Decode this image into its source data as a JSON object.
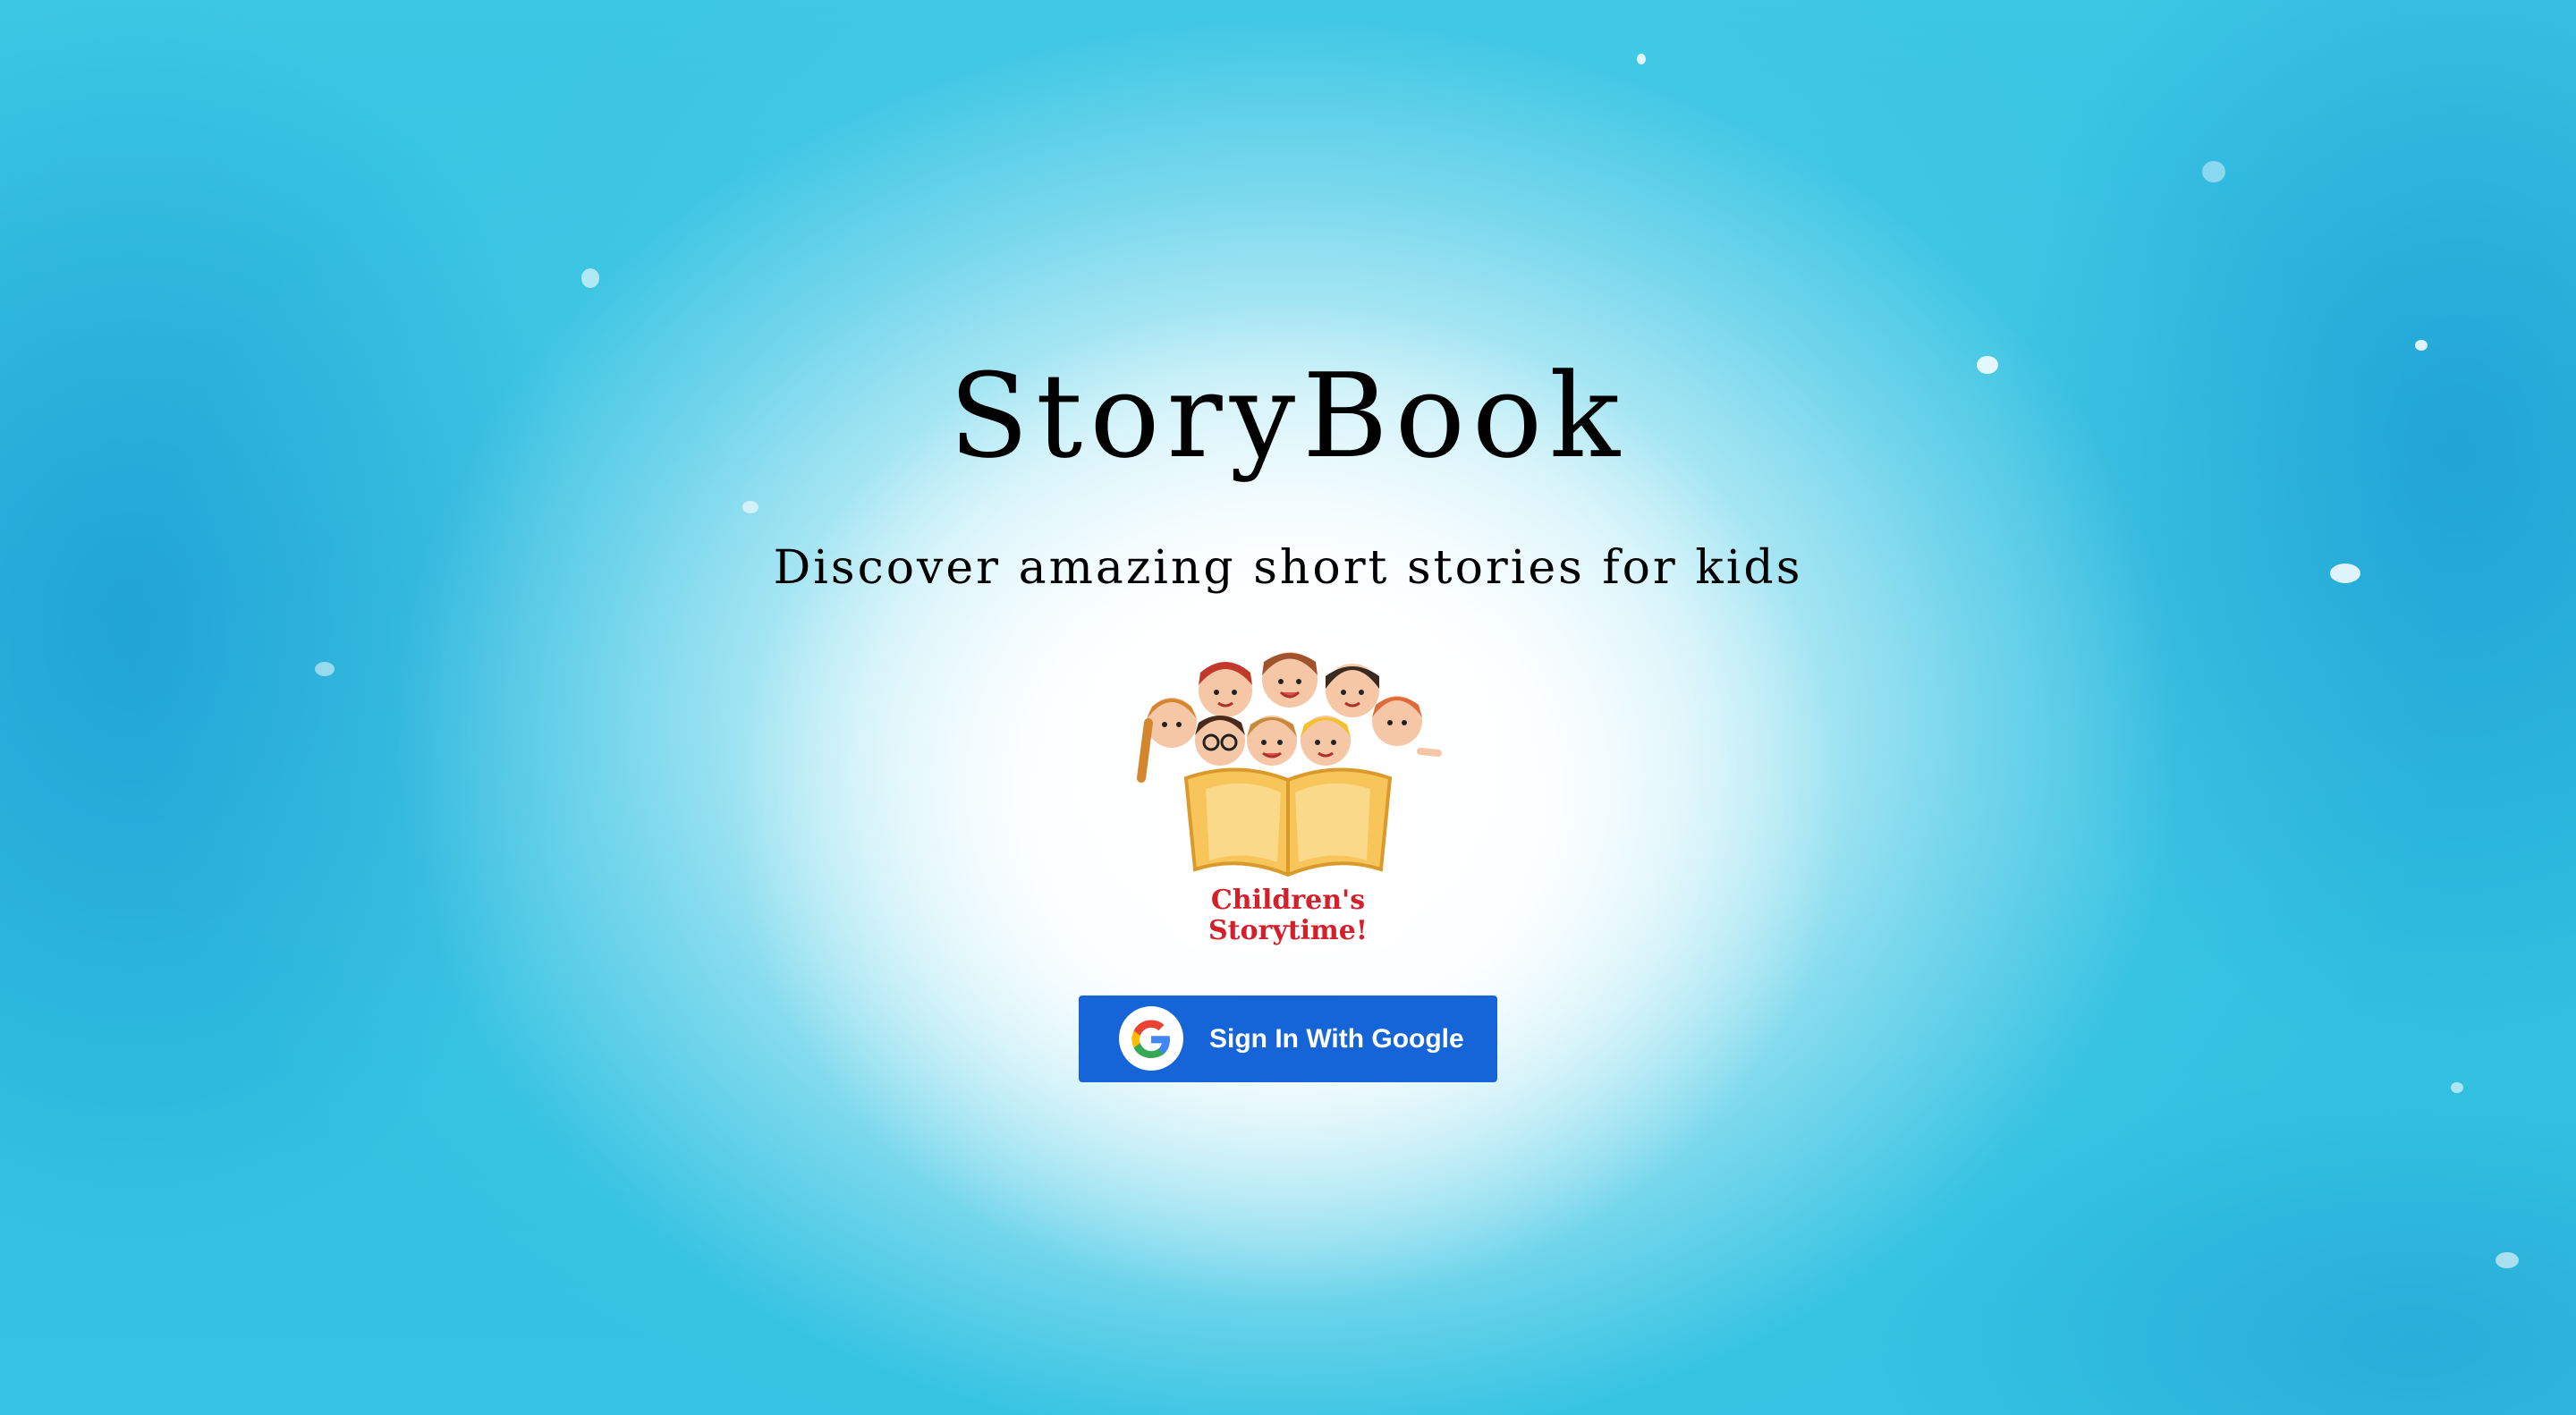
{
  "page": {
    "title": "StoryBook",
    "subtitle": "Discover amazing short stories for kids"
  },
  "logo": {
    "icon": "children-storytime-logo",
    "text_line1": "Children's",
    "text_line2": "Storytime!"
  },
  "signin": {
    "label": "Sign In With Google",
    "icon": "google-icon"
  },
  "colors": {
    "button_bg": "#1565d8",
    "button_text": "#ffffff",
    "background_accent": "#29c0e0"
  }
}
